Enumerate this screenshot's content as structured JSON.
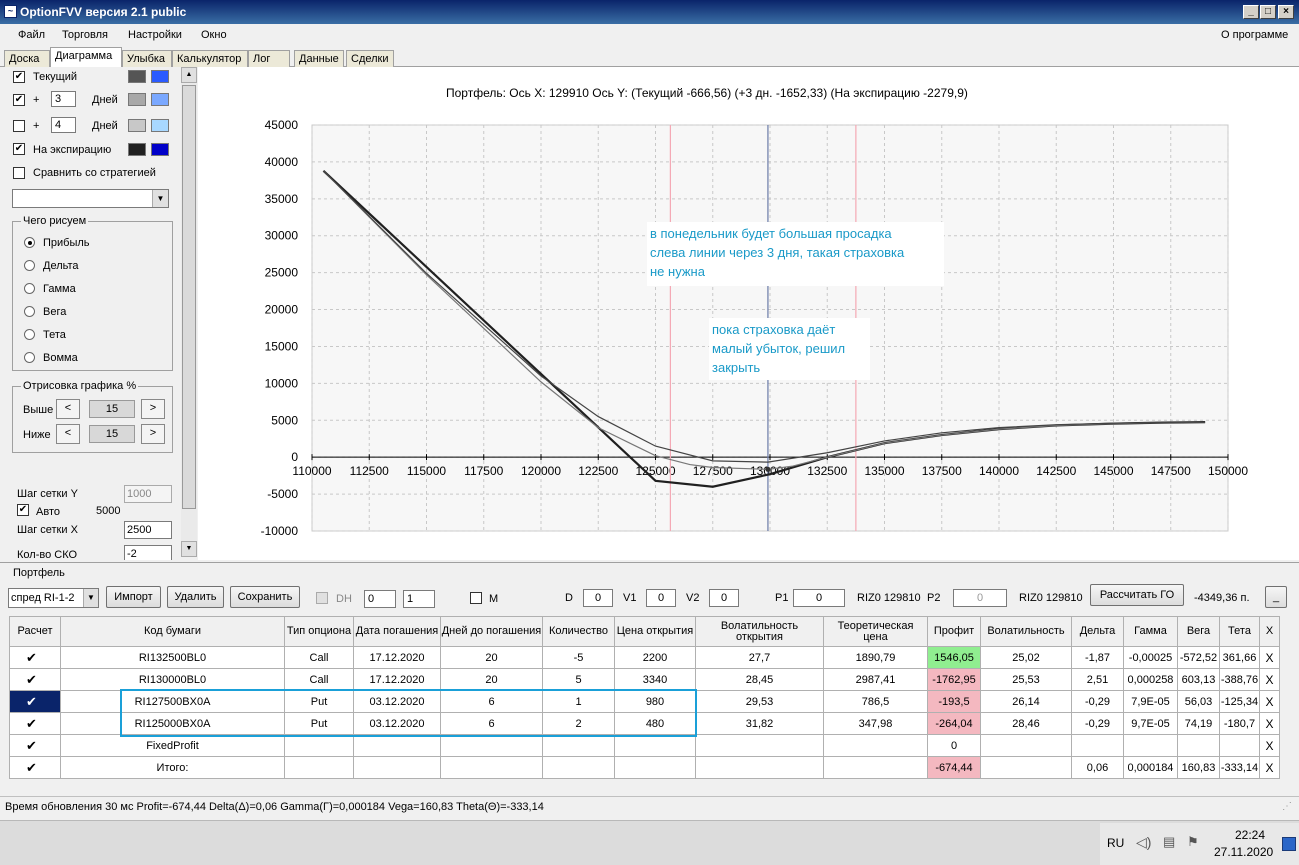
{
  "window": {
    "title": "OptionFVV версия 2.1 public"
  },
  "menu": {
    "items": [
      "Файл",
      "Торговля",
      "Настройки",
      "Окно"
    ],
    "about": "О программе"
  },
  "tabs": [
    "Доска",
    "Диаграмма",
    "Улыбка",
    "Калькулятор",
    "Лог",
    "Данные",
    "Сделки"
  ],
  "active_tab": "Диаграмма",
  "left": {
    "current_label": "Текущий",
    "plus": "+",
    "days_label": "Дней",
    "days1": "3",
    "days2": "4",
    "expiry_label": "На экспирацию",
    "compare_label": "Сравнить со стратегией",
    "draw_group": "Чего рисуем",
    "draw_options": [
      "Прибыль",
      "Дельта",
      "Гамма",
      "Вега",
      "Тета",
      "Вомма"
    ],
    "scale_group": "Отрисовка графика %",
    "above_label": "Выше",
    "below_label": "Ниже",
    "above_value": "15",
    "below_value": "15",
    "grid_y_label": "Шаг сетки Y",
    "grid_y_value": "1000",
    "auto_label": "Авто",
    "auto_value": "5000",
    "grid_x_label": "Шаг сетки X",
    "grid_x_value": "2500",
    "sko_label": "Кол-во СКО",
    "sko_value": "-2",
    "colors": {
      "current": [
        "#555555",
        "#2b5bff"
      ],
      "plus1": [
        "#a8a8a8",
        "#7aa8ff"
      ],
      "plus2": [
        "#c8c8c8",
        "#a8d8ff"
      ],
      "expiry": [
        "#202020",
        "#0000c8"
      ]
    },
    "arrows": {
      "left": "<",
      "right": ">"
    }
  },
  "chart_header": "Портфель: Ось X:  129910 Ось Y:  (Текущий -666,56)  (+3 дн. -1652,33)  (На экспирацию -2279,9)",
  "chart_data": {
    "type": "line",
    "xlim": [
      110000,
      150000
    ],
    "ylim": [
      -10000,
      45000
    ],
    "x_ticks": [
      110000,
      112500,
      115000,
      117500,
      120000,
      122500,
      125000,
      127500,
      130000,
      132500,
      135000,
      137500,
      140000,
      142500,
      145000,
      147500,
      150000
    ],
    "y_ticks": [
      -10000,
      -5000,
      0,
      5000,
      10000,
      15000,
      20000,
      25000,
      30000,
      35000,
      40000,
      45000
    ],
    "grid": true,
    "vlines": {
      "current": 129910,
      "bounds": [
        125650,
        133750
      ]
    },
    "series": [
      {
        "color": "#202020",
        "width": 2.2,
        "x": [
          110500,
          125000,
          127500,
          130000,
          132500,
          135000,
          137500,
          140000,
          142500,
          145000,
          147500,
          149000
        ],
        "y": [
          38800,
          -3200,
          -4000,
          -2300,
          0,
          1900,
          3000,
          3800,
          4300,
          4550,
          4700,
          4750
        ]
      },
      {
        "color": "#777777",
        "width": 1.2,
        "x": [
          110500,
          115000,
          120000,
          122500,
          125000,
          126500,
          127500,
          129910,
          131000,
          132500,
          135000,
          137500,
          140000,
          142500,
          145000,
          147500,
          149000
        ],
        "y": [
          38800,
          24700,
          10200,
          4000,
          200,
          -1000,
          -1400,
          -1650,
          -1200,
          0,
          1900,
          3000,
          3800,
          4300,
          4550,
          4700,
          4750
        ]
      },
      {
        "color": "#444444",
        "width": 1.2,
        "x": [
          110500,
          115000,
          120000,
          122500,
          125000,
          127500,
          129910,
          132500,
          135000,
          137500,
          140000,
          142500,
          145000,
          147500,
          149000
        ],
        "y": [
          38800,
          24900,
          11000,
          5500,
          1500,
          -500,
          -670,
          600,
          2200,
          3300,
          4000,
          4400,
          4600,
          4720,
          4760
        ]
      }
    ],
    "annotations": [
      "в понедельник будет большая просадка\nслева линии через 3 дня, такая страховка\nне нужна",
      "пока страховка даёт\nмалый убыток, решил\nзакрыть"
    ]
  },
  "portfolio": {
    "label": "Портфель",
    "strategy": "спред RI-1-2",
    "buttons": {
      "import": "Импорт",
      "delete": "Удалить",
      "save": "Сохранить",
      "calc": "Рассчитать ГО",
      "minimize": "_"
    },
    "dh_label": "DH",
    "dh_val1": "0",
    "dh_val2": "1",
    "m_label": "M",
    "d_label": "D",
    "d_val": "0",
    "v1_label": "V1",
    "v1_val": "0",
    "v2_label": "V2",
    "v2_val": "0",
    "p1_label": "P1",
    "p1_val": "0",
    "p1_ref": "RIZ0 129810",
    "p2_label": "P2",
    "p2_val": "0",
    "p2_ref": "RIZ0 129810",
    "go_value": "-4349,36 п."
  },
  "grid": {
    "headers": [
      "Расчет",
      "Код бумаги",
      "Тип опциона",
      "Дата погашения",
      "Дней до погашения",
      "Количество",
      "Цена открытия",
      "Волатильность открытия",
      "Теоретическая цена",
      "Профит",
      "Волатильность",
      "Дельта",
      "Гамма",
      "Вега",
      "Тета",
      "X"
    ],
    "rows": [
      [
        "✔",
        "RI132500BL0",
        "Call",
        "17.12.2020",
        "20",
        "-5",
        "2200",
        "27,7",
        "1890,79",
        "1546,05",
        "25,02",
        "-1,87",
        "-0,00025",
        "-572,52",
        "361,66",
        "X"
      ],
      [
        "✔",
        "RI130000BL0",
        "Call",
        "17.12.2020",
        "20",
        "5",
        "3340",
        "28,45",
        "2987,41",
        "-1762,95",
        "25,53",
        "2,51",
        "0,000258",
        "603,13",
        "-388,76",
        "X"
      ],
      [
        "✔",
        "RI127500BX0A",
        "Put",
        "03.12.2020",
        "6",
        "1",
        "980",
        "29,53",
        "786,5",
        "-193,5",
        "26,14",
        "-0,29",
        "7,9E-05",
        "56,03",
        "-125,34",
        "X"
      ],
      [
        "✔",
        "RI125000BX0A",
        "Put",
        "03.12.2020",
        "6",
        "2",
        "480",
        "31,82",
        "347,98",
        "-264,04",
        "28,46",
        "-0,29",
        "9,7E-05",
        "74,19",
        "-180,7",
        "X"
      ],
      [
        "✔",
        "FixedProfit",
        "",
        "",
        "",
        "",
        "",
        "",
        "",
        "0",
        "",
        "",
        "",
        "",
        "",
        "X"
      ],
      [
        "✔",
        "Итого:",
        "",
        "",
        "",
        "",
        "",
        "",
        "",
        "-674,44",
        "",
        "0,06",
        "0,000184",
        "160,83",
        "-333,14",
        "X"
      ]
    ]
  },
  "status": "Время обновления 30 мс  Profit=-674,44 Delta(Δ)=0,06 Gamma(Γ)=0,000184 Vega=160,83 Theta(Θ)=-333,14",
  "taskbar": {
    "lang": "RU",
    "time": "22:24",
    "date": "27.11.2020"
  }
}
